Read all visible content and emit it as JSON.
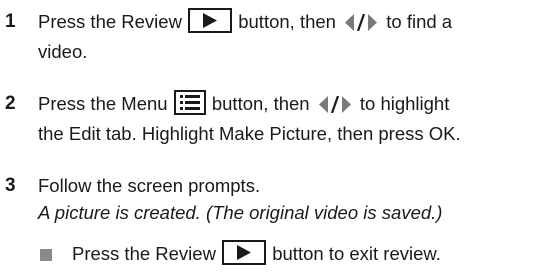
{
  "steps": [
    {
      "number": "1",
      "part1": "Press the Review",
      "part2": "button, then",
      "part3": "to find a",
      "line2": "video."
    },
    {
      "number": "2",
      "part1": "Press the Menu",
      "part2": "button, then",
      "part3": "to highlight",
      "line2": "the Edit tab. Highlight Make Picture, then press OK."
    },
    {
      "number": "3",
      "line1": "Follow the screen prompts.",
      "result": "A picture is created. (The original video is saved.)"
    }
  ],
  "bullet": {
    "part1": "Press the Review",
    "part2": "button to exit review."
  },
  "icons": {
    "review": "review-play-button-icon",
    "menu": "menu-button-icon",
    "nav": "left-right-arrows-icon"
  },
  "colors": {
    "text": "#1a1a1a",
    "bullet": "#8a8a8a",
    "arrows": "#7a7a7a"
  }
}
